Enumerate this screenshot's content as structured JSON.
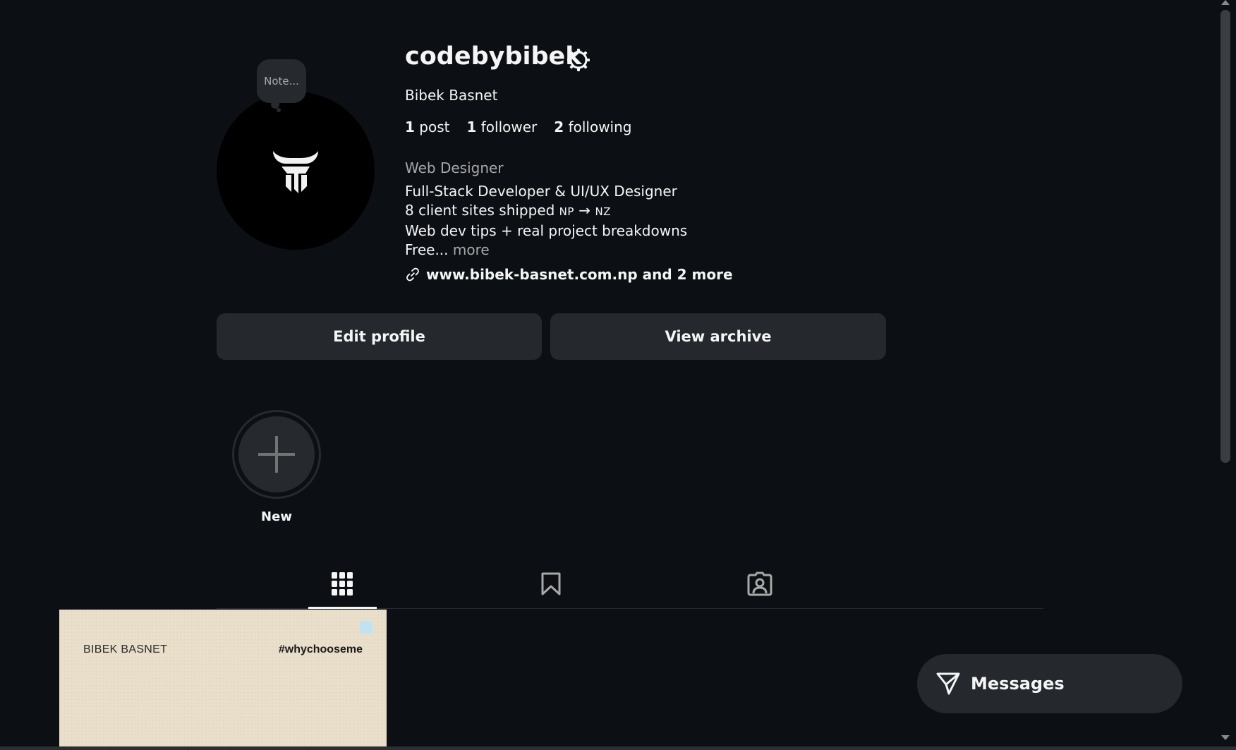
{
  "profile": {
    "note_placeholder": "Note...",
    "username": "codebybibek",
    "full_name": "Bibek Basnet",
    "stats": {
      "posts_count": "1",
      "posts_label": "post",
      "followers_count": "1",
      "followers_label": "follower",
      "following_count": "2",
      "following_label": "following"
    },
    "category": "Web Designer",
    "bio": {
      "line1": "Full-Stack Developer & UI/UX Designer",
      "line2_prefix": "8 client sites shipped ",
      "line2_from": "NP",
      "line2_arrow": " → ",
      "line2_to": "NZ",
      "line3": "Web dev tips + real project breakdowns",
      "line4": "Free...",
      "more": "more"
    },
    "link_text": "www.bibek-basnet.com.np and 2 more"
  },
  "buttons": {
    "edit_profile": "Edit profile",
    "view_archive": "View archive"
  },
  "highlights": {
    "new_label": "New"
  },
  "tabs": [
    {
      "name": "posts",
      "icon": "grid-icon",
      "active": true
    },
    {
      "name": "saved",
      "icon": "bookmark-icon",
      "active": false
    },
    {
      "name": "tagged",
      "icon": "tagged-user-icon",
      "active": false
    }
  ],
  "posts": [
    {
      "left_text": "BIBEK BASNET",
      "right_text": "#whychooseme"
    }
  ],
  "messages": {
    "label": "Messages"
  },
  "colors": {
    "background": "#0c1014",
    "surface": "#25292e",
    "text": "#f5f5f5",
    "muted": "#a8a8a8"
  }
}
